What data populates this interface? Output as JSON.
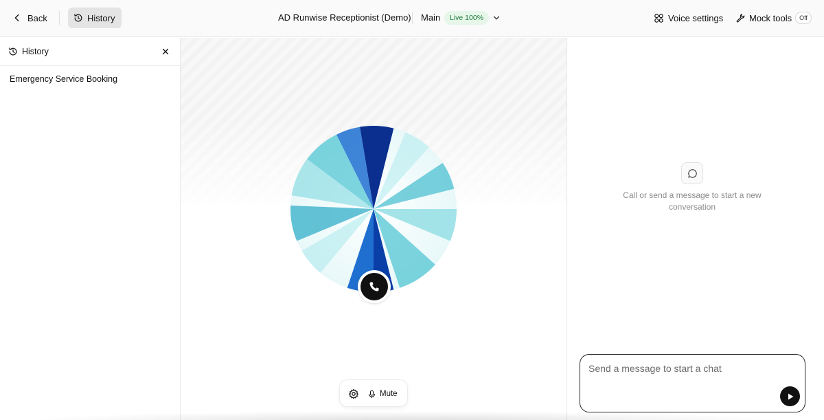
{
  "topbar": {
    "back_label": "Back",
    "history_label": "History",
    "agent_title": "AD Runwise Receptionist (Demo)",
    "branch_label": "Main",
    "live_badge": "Live 100%",
    "voice_settings_label": "Voice settings",
    "mock_tools_label": "Mock tools",
    "mock_tools_state": "Off"
  },
  "history_panel": {
    "title": "History",
    "items": [
      {
        "label": "Emergency Service Booking"
      }
    ]
  },
  "call_area": {
    "mute_label": "Mute",
    "orb_colors": {
      "deep": "#0a2f8f",
      "mid": "#1f6fd0",
      "light": "#5cc9d6",
      "pale": "#e8f8f9"
    }
  },
  "chat": {
    "empty_message": "Call or send a message to start a new conversation",
    "input_placeholder": "Send a message to start a chat"
  },
  "colors": {
    "live_badge_bg": "#e6f7ea",
    "live_badge_text": "#1f7a3a",
    "history_btn_bg": "#e4e4e4"
  }
}
